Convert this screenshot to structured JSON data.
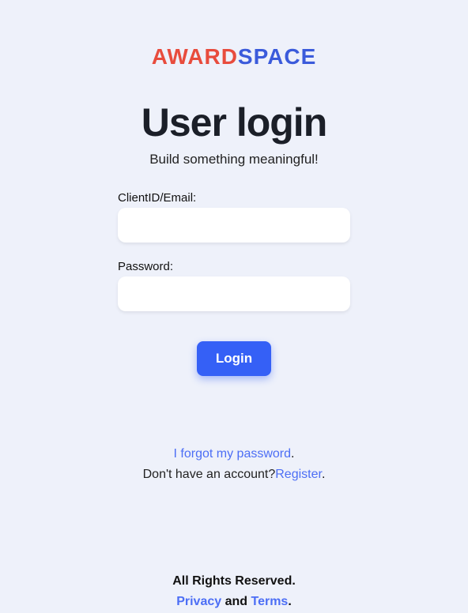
{
  "logo": {
    "part1": "AWARD",
    "part2": "SPACE"
  },
  "heading": "User login",
  "subtitle": "Build something meaningful!",
  "form": {
    "clientid_label": "ClientID/Email:",
    "password_label": "Password:",
    "login_button": "Login"
  },
  "links": {
    "forgot_password": "I forgot my password",
    "no_account_text": "Don't have an account?",
    "register": "Register"
  },
  "footer": {
    "rights": "All Rights Reserved.",
    "privacy": "Privacy",
    "and": " and ",
    "terms": "Terms"
  },
  "punctuation": {
    "period": "."
  }
}
